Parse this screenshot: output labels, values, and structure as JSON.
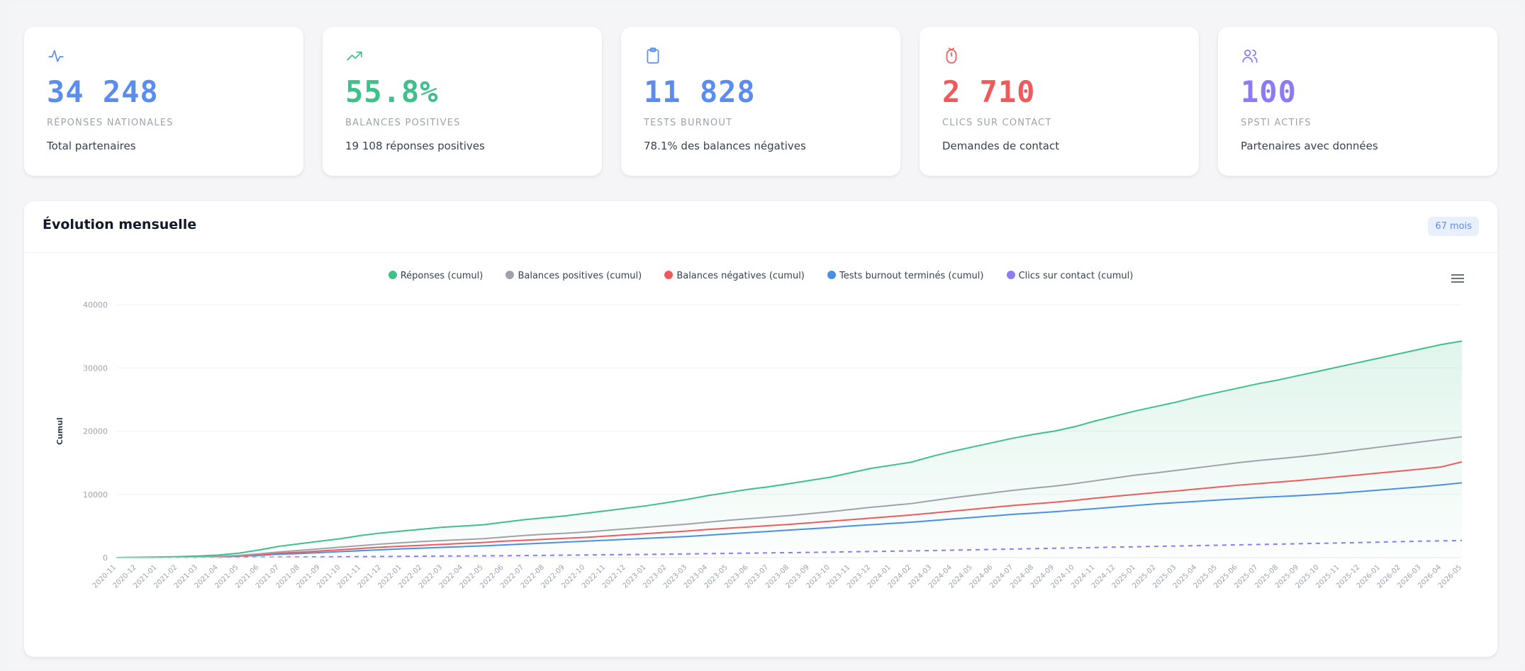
{
  "cards": [
    {
      "value": "34 248",
      "label": "RÉPONSES NATIONALES",
      "sub": "Total partenaires",
      "color": "#5b8def",
      "icon": "activity-icon"
    },
    {
      "value": "55.8%",
      "label": "BALANCES POSITIVES",
      "sub": "19 108 réponses positives",
      "color": "#3fbf8a",
      "icon": "trending-up-icon"
    },
    {
      "value": "11 828",
      "label": "TESTS BURNOUT",
      "sub": "78.1% des balances négatives",
      "color": "#5b8def",
      "icon": "clipboard-icon"
    },
    {
      "value": "2 710",
      "label": "CLICS SUR CONTACT",
      "sub": "Demandes de contact",
      "color": "#ef5b5b",
      "icon": "mouse-icon"
    },
    {
      "value": "100",
      "label": "SPSTI ACTIFS",
      "sub": "Partenaires avec données",
      "color": "#8b7cf6",
      "icon": "users-icon"
    }
  ],
  "panel": {
    "title": "Évolution mensuelle",
    "badge": "67 mois"
  },
  "chart_data": {
    "type": "line",
    "title": "",
    "xlabel": "",
    "ylabel": "Cumul",
    "ylim": [
      0,
      40000
    ],
    "yticks": [
      0,
      10000,
      20000,
      30000,
      40000
    ],
    "grid": true,
    "legend_position": "top-center",
    "x": [
      "2020-11",
      "2020-12",
      "2021-01",
      "2021-02",
      "2021-03",
      "2021-04",
      "2021-05",
      "2021-06",
      "2021-07",
      "2021-08",
      "2021-09",
      "2021-10",
      "2021-11",
      "2021-12",
      "2022-01",
      "2022-02",
      "2022-03",
      "2022-04",
      "2022-05",
      "2022-06",
      "2022-07",
      "2022-08",
      "2022-09",
      "2022-10",
      "2022-11",
      "2022-12",
      "2023-01",
      "2023-02",
      "2023-03",
      "2023-04",
      "2023-05",
      "2023-06",
      "2023-07",
      "2023-08",
      "2023-09",
      "2023-10",
      "2023-11",
      "2023-12",
      "2024-01",
      "2024-02",
      "2024-03",
      "2024-04",
      "2024-05",
      "2024-06",
      "2024-07",
      "2024-08",
      "2024-09",
      "2024-10",
      "2024-11",
      "2024-12",
      "2025-01",
      "2025-02",
      "2025-03",
      "2025-04",
      "2025-05",
      "2025-06",
      "2025-07",
      "2025-08",
      "2025-09",
      "2025-10",
      "2025-11",
      "2025-12",
      "2026-01",
      "2026-02",
      "2026-03",
      "2026-04",
      "2026-05"
    ],
    "series": [
      {
        "name": "Réponses (cumul)",
        "color": "#3fbf8a",
        "dash": false,
        "values": [
          0,
          50,
          100,
          150,
          250,
          400,
          700,
          1200,
          1800,
          2200,
          2600,
          3000,
          3500,
          3900,
          4200,
          4500,
          4800,
          5000,
          5200,
          5600,
          6000,
          6300,
          6600,
          7000,
          7400,
          7800,
          8200,
          8700,
          9200,
          9800,
          10300,
          10800,
          11200,
          11700,
          12200,
          12700,
          13400,
          14100,
          14600,
          15100,
          16000,
          16800,
          17500,
          18200,
          18900,
          19500,
          20000,
          20700,
          21600,
          22400,
          23200,
          23900,
          24600,
          25400,
          26100,
          26800,
          27500,
          28100,
          28800,
          29500,
          30200,
          30900,
          31600,
          32300,
          33000,
          33700,
          34248
        ]
      },
      {
        "name": "Balances positives (cumul)",
        "color": "#a1a1aa",
        "dash": false,
        "values": [
          0,
          20,
          50,
          80,
          130,
          200,
          350,
          600,
          900,
          1150,
          1400,
          1650,
          1900,
          2150,
          2350,
          2550,
          2700,
          2850,
          3000,
          3250,
          3500,
          3700,
          3850,
          4050,
          4300,
          4550,
          4800,
          5050,
          5300,
          5600,
          5900,
          6150,
          6400,
          6650,
          6950,
          7250,
          7600,
          7950,
          8250,
          8550,
          9000,
          9450,
          9850,
          10250,
          10650,
          11000,
          11300,
          11700,
          12150,
          12600,
          13050,
          13400,
          13800,
          14200,
          14600,
          15000,
          15350,
          15650,
          15950,
          16300,
          16700,
          17100,
          17500,
          17900,
          18300,
          18700,
          19108
        ]
      },
      {
        "name": "Balances négatives (cumul)",
        "color": "#ef5b5b",
        "dash": false,
        "values": [
          0,
          20,
          40,
          60,
          100,
          160,
          280,
          450,
          700,
          850,
          1050,
          1250,
          1450,
          1650,
          1800,
          1950,
          2100,
          2250,
          2400,
          2600,
          2750,
          2900,
          3050,
          3200,
          3400,
          3600,
          3800,
          4000,
          4200,
          4450,
          4650,
          4850,
          5050,
          5250,
          5500,
          5750,
          6000,
          6250,
          6500,
          6750,
          7050,
          7350,
          7650,
          7950,
          8250,
          8500,
          8750,
          9050,
          9400,
          9700,
          10000,
          10300,
          10550,
          10850,
          11150,
          11450,
          11700,
          11950,
          12200,
          12500,
          12800,
          13100,
          13400,
          13700,
          14000,
          14350,
          15140
        ]
      },
      {
        "name": "Tests burnout terminés (cumul)",
        "color": "#4a90e2",
        "dash": false,
        "values": [
          0,
          15,
          30,
          50,
          80,
          130,
          220,
          350,
          550,
          650,
          800,
          950,
          1100,
          1250,
          1380,
          1500,
          1620,
          1740,
          1860,
          2000,
          2150,
          2300,
          2450,
          2600,
          2750,
          2900,
          3050,
          3200,
          3350,
          3550,
          3750,
          3950,
          4150,
          4350,
          4550,
          4750,
          5000,
          5200,
          5400,
          5600,
          5850,
          6100,
          6350,
          6600,
          6850,
          7050,
          7250,
          7500,
          7750,
          8000,
          8250,
          8500,
          8700,
          8900,
          9100,
          9300,
          9500,
          9650,
          9800,
          10000,
          10200,
          10450,
          10700,
          10950,
          11200,
          11500,
          11828
        ]
      },
      {
        "name": "Clics sur contact (cumul)",
        "color": "#8b7cf6",
        "dash": true,
        "values": [
          0,
          5,
          10,
          15,
          20,
          30,
          40,
          60,
          80,
          100,
          120,
          140,
          160,
          180,
          200,
          220,
          240,
          260,
          280,
          300,
          330,
          360,
          390,
          420,
          450,
          480,
          510,
          550,
          590,
          630,
          670,
          710,
          750,
          790,
          830,
          870,
          920,
          970,
          1020,
          1070,
          1120,
          1180,
          1240,
          1300,
          1360,
          1420,
          1480,
          1540,
          1600,
          1660,
          1720,
          1780,
          1840,
          1900,
          1960,
          2020,
          2080,
          2140,
          2200,
          2260,
          2320,
          2390,
          2460,
          2530,
          2600,
          2650,
          2710
        ]
      }
    ]
  }
}
